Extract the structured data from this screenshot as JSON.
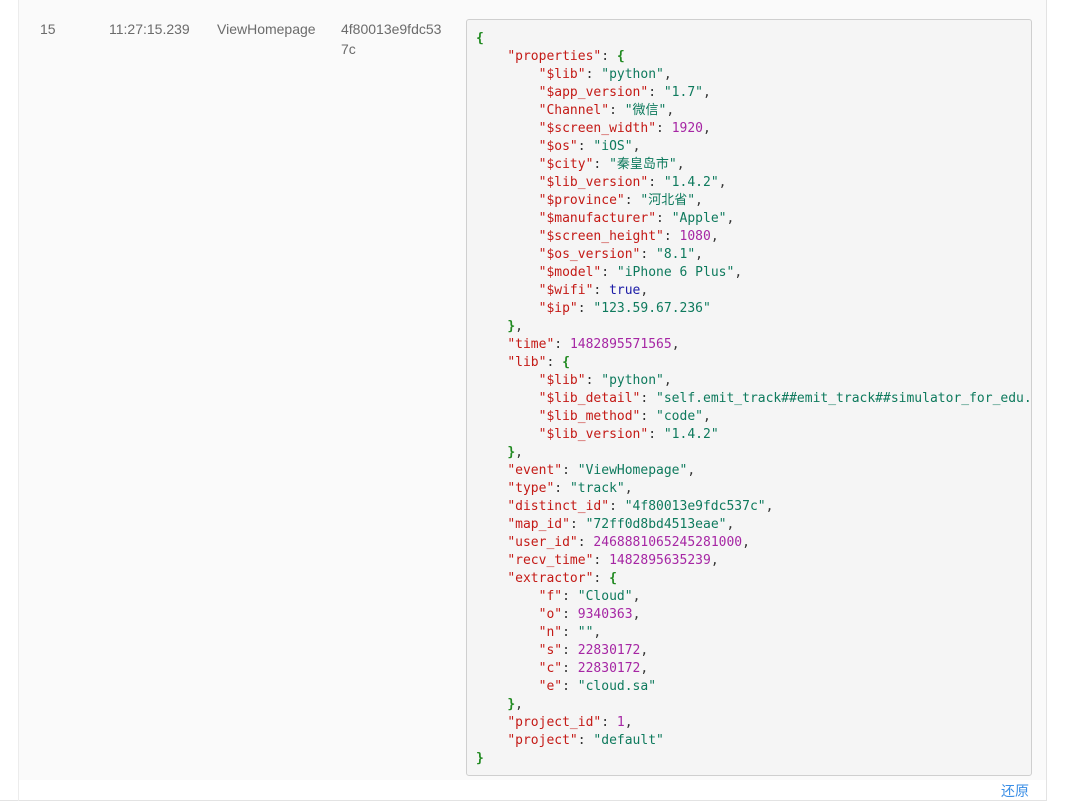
{
  "row": {
    "index": "15",
    "time": "11:27:15.239",
    "event": "ViewHomepage",
    "distinct_id_display": "4f80013e9fdc537c"
  },
  "json_lines": [
    {
      "indent": 0,
      "parts": [
        {
          "t": "{",
          "c": "p"
        }
      ]
    },
    {
      "indent": 1,
      "parts": [
        {
          "t": "\"properties\"",
          "c": "k"
        },
        {
          "t": ": ",
          "c": ""
        },
        {
          "t": "{",
          "c": "p"
        }
      ]
    },
    {
      "indent": 2,
      "parts": [
        {
          "t": "\"$lib\"",
          "c": "k"
        },
        {
          "t": ": ",
          "c": ""
        },
        {
          "t": "\"python\"",
          "c": "s"
        },
        {
          "t": ",",
          "c": ""
        }
      ]
    },
    {
      "indent": 2,
      "parts": [
        {
          "t": "\"$app_version\"",
          "c": "k"
        },
        {
          "t": ": ",
          "c": ""
        },
        {
          "t": "\"1.7\"",
          "c": "s"
        },
        {
          "t": ",",
          "c": ""
        }
      ]
    },
    {
      "indent": 2,
      "parts": [
        {
          "t": "\"Channel\"",
          "c": "k"
        },
        {
          "t": ": ",
          "c": ""
        },
        {
          "t": "\"微信\"",
          "c": "s"
        },
        {
          "t": ",",
          "c": ""
        }
      ]
    },
    {
      "indent": 2,
      "parts": [
        {
          "t": "\"$screen_width\"",
          "c": "k"
        },
        {
          "t": ": ",
          "c": ""
        },
        {
          "t": "1920",
          "c": "n"
        },
        {
          "t": ",",
          "c": ""
        }
      ]
    },
    {
      "indent": 2,
      "parts": [
        {
          "t": "\"$os\"",
          "c": "k"
        },
        {
          "t": ": ",
          "c": ""
        },
        {
          "t": "\"iOS\"",
          "c": "s"
        },
        {
          "t": ",",
          "c": ""
        }
      ]
    },
    {
      "indent": 2,
      "parts": [
        {
          "t": "\"$city\"",
          "c": "k"
        },
        {
          "t": ": ",
          "c": ""
        },
        {
          "t": "\"秦皇岛市\"",
          "c": "s"
        },
        {
          "t": ",",
          "c": ""
        }
      ]
    },
    {
      "indent": 2,
      "parts": [
        {
          "t": "\"$lib_version\"",
          "c": "k"
        },
        {
          "t": ": ",
          "c": ""
        },
        {
          "t": "\"1.4.2\"",
          "c": "s"
        },
        {
          "t": ",",
          "c": ""
        }
      ]
    },
    {
      "indent": 2,
      "parts": [
        {
          "t": "\"$province\"",
          "c": "k"
        },
        {
          "t": ": ",
          "c": ""
        },
        {
          "t": "\"河北省\"",
          "c": "s"
        },
        {
          "t": ",",
          "c": ""
        }
      ]
    },
    {
      "indent": 2,
      "parts": [
        {
          "t": "\"$manufacturer\"",
          "c": "k"
        },
        {
          "t": ": ",
          "c": ""
        },
        {
          "t": "\"Apple\"",
          "c": "s"
        },
        {
          "t": ",",
          "c": ""
        }
      ]
    },
    {
      "indent": 2,
      "parts": [
        {
          "t": "\"$screen_height\"",
          "c": "k"
        },
        {
          "t": ": ",
          "c": ""
        },
        {
          "t": "1080",
          "c": "n"
        },
        {
          "t": ",",
          "c": ""
        }
      ]
    },
    {
      "indent": 2,
      "parts": [
        {
          "t": "\"$os_version\"",
          "c": "k"
        },
        {
          "t": ": ",
          "c": ""
        },
        {
          "t": "\"8.1\"",
          "c": "s"
        },
        {
          "t": ",",
          "c": ""
        }
      ]
    },
    {
      "indent": 2,
      "parts": [
        {
          "t": "\"$model\"",
          "c": "k"
        },
        {
          "t": ": ",
          "c": ""
        },
        {
          "t": "\"iPhone 6 Plus\"",
          "c": "s"
        },
        {
          "t": ",",
          "c": ""
        }
      ]
    },
    {
      "indent": 2,
      "parts": [
        {
          "t": "\"$wifi\"",
          "c": "k"
        },
        {
          "t": ": ",
          "c": ""
        },
        {
          "t": "true",
          "c": "b"
        },
        {
          "t": ",",
          "c": ""
        }
      ]
    },
    {
      "indent": 2,
      "parts": [
        {
          "t": "\"$ip\"",
          "c": "k"
        },
        {
          "t": ": ",
          "c": ""
        },
        {
          "t": "\"123.59.67.236\"",
          "c": "s"
        }
      ]
    },
    {
      "indent": 1,
      "parts": [
        {
          "t": "}",
          "c": "p"
        },
        {
          "t": ",",
          "c": ""
        }
      ]
    },
    {
      "indent": 1,
      "parts": [
        {
          "t": "\"time\"",
          "c": "k"
        },
        {
          "t": ": ",
          "c": ""
        },
        {
          "t": "1482895571565",
          "c": "n"
        },
        {
          "t": ",",
          "c": ""
        }
      ]
    },
    {
      "indent": 1,
      "parts": [
        {
          "t": "\"lib\"",
          "c": "k"
        },
        {
          "t": ": ",
          "c": ""
        },
        {
          "t": "{",
          "c": "p"
        }
      ]
    },
    {
      "indent": 2,
      "parts": [
        {
          "t": "\"$lib\"",
          "c": "k"
        },
        {
          "t": ": ",
          "c": ""
        },
        {
          "t": "\"python\"",
          "c": "s"
        },
        {
          "t": ",",
          "c": ""
        }
      ]
    },
    {
      "indent": 2,
      "parts": [
        {
          "t": "\"$lib_detail\"",
          "c": "k"
        },
        {
          "t": ": ",
          "c": ""
        },
        {
          "t": "\"self.emit_track##emit_track##simulator_for_edu.",
          "c": "s"
        }
      ]
    },
    {
      "indent": 2,
      "parts": [
        {
          "t": "\"$lib_method\"",
          "c": "k"
        },
        {
          "t": ": ",
          "c": ""
        },
        {
          "t": "\"code\"",
          "c": "s"
        },
        {
          "t": ",",
          "c": ""
        }
      ]
    },
    {
      "indent": 2,
      "parts": [
        {
          "t": "\"$lib_version\"",
          "c": "k"
        },
        {
          "t": ": ",
          "c": ""
        },
        {
          "t": "\"1.4.2\"",
          "c": "s"
        }
      ]
    },
    {
      "indent": 1,
      "parts": [
        {
          "t": "}",
          "c": "p"
        },
        {
          "t": ",",
          "c": ""
        }
      ]
    },
    {
      "indent": 1,
      "parts": [
        {
          "t": "\"event\"",
          "c": "k"
        },
        {
          "t": ": ",
          "c": ""
        },
        {
          "t": "\"ViewHomepage\"",
          "c": "s"
        },
        {
          "t": ",",
          "c": ""
        }
      ]
    },
    {
      "indent": 1,
      "parts": [
        {
          "t": "\"type\"",
          "c": "k"
        },
        {
          "t": ": ",
          "c": ""
        },
        {
          "t": "\"track\"",
          "c": "s"
        },
        {
          "t": ",",
          "c": ""
        }
      ]
    },
    {
      "indent": 1,
      "parts": [
        {
          "t": "\"distinct_id\"",
          "c": "k"
        },
        {
          "t": ": ",
          "c": ""
        },
        {
          "t": "\"4f80013e9fdc537c\"",
          "c": "s"
        },
        {
          "t": ",",
          "c": ""
        }
      ]
    },
    {
      "indent": 1,
      "parts": [
        {
          "t": "\"map_id\"",
          "c": "k"
        },
        {
          "t": ": ",
          "c": ""
        },
        {
          "t": "\"72ff0d8bd4513eae\"",
          "c": "s"
        },
        {
          "t": ",",
          "c": ""
        }
      ]
    },
    {
      "indent": 1,
      "parts": [
        {
          "t": "\"user_id\"",
          "c": "k"
        },
        {
          "t": ": ",
          "c": ""
        },
        {
          "t": "2468881065245281000",
          "c": "n"
        },
        {
          "t": ",",
          "c": ""
        }
      ]
    },
    {
      "indent": 1,
      "parts": [
        {
          "t": "\"recv_time\"",
          "c": "k"
        },
        {
          "t": ": ",
          "c": ""
        },
        {
          "t": "1482895635239",
          "c": "n"
        },
        {
          "t": ",",
          "c": ""
        }
      ]
    },
    {
      "indent": 1,
      "parts": [
        {
          "t": "\"extractor\"",
          "c": "k"
        },
        {
          "t": ": ",
          "c": ""
        },
        {
          "t": "{",
          "c": "p"
        }
      ]
    },
    {
      "indent": 2,
      "parts": [
        {
          "t": "\"f\"",
          "c": "k"
        },
        {
          "t": ": ",
          "c": ""
        },
        {
          "t": "\"Cloud\"",
          "c": "s"
        },
        {
          "t": ",",
          "c": ""
        }
      ]
    },
    {
      "indent": 2,
      "parts": [
        {
          "t": "\"o\"",
          "c": "k"
        },
        {
          "t": ": ",
          "c": ""
        },
        {
          "t": "9340363",
          "c": "n"
        },
        {
          "t": ",",
          "c": ""
        }
      ]
    },
    {
      "indent": 2,
      "parts": [
        {
          "t": "\"n\"",
          "c": "k"
        },
        {
          "t": ": ",
          "c": ""
        },
        {
          "t": "\"\"",
          "c": "s"
        },
        {
          "t": ",",
          "c": ""
        }
      ]
    },
    {
      "indent": 2,
      "parts": [
        {
          "t": "\"s\"",
          "c": "k"
        },
        {
          "t": ": ",
          "c": ""
        },
        {
          "t": "22830172",
          "c": "n"
        },
        {
          "t": ",",
          "c": ""
        }
      ]
    },
    {
      "indent": 2,
      "parts": [
        {
          "t": "\"c\"",
          "c": "k"
        },
        {
          "t": ": ",
          "c": ""
        },
        {
          "t": "22830172",
          "c": "n"
        },
        {
          "t": ",",
          "c": ""
        }
      ]
    },
    {
      "indent": 2,
      "parts": [
        {
          "t": "\"e\"",
          "c": "k"
        },
        {
          "t": ": ",
          "c": ""
        },
        {
          "t": "\"cloud.sa\"",
          "c": "s"
        }
      ]
    },
    {
      "indent": 1,
      "parts": [
        {
          "t": "}",
          "c": "p"
        },
        {
          "t": ",",
          "c": ""
        }
      ]
    },
    {
      "indent": 1,
      "parts": [
        {
          "t": "\"project_id\"",
          "c": "k"
        },
        {
          "t": ": ",
          "c": ""
        },
        {
          "t": "1",
          "c": "n"
        },
        {
          "t": ",",
          "c": ""
        }
      ]
    },
    {
      "indent": 1,
      "parts": [
        {
          "t": "\"project\"",
          "c": "k"
        },
        {
          "t": ": ",
          "c": ""
        },
        {
          "t": "\"default\"",
          "c": "s"
        }
      ]
    },
    {
      "indent": 0,
      "parts": [
        {
          "t": "}",
          "c": "p"
        }
      ]
    }
  ],
  "actions": {
    "restore_label": "还原"
  },
  "colors": {
    "key": "#c41a16",
    "string": "#0e7a5d",
    "number": "#a626a4",
    "boolean": "#1a1aa6",
    "punctuation": "#218a21",
    "link": "#3a8ee6"
  }
}
